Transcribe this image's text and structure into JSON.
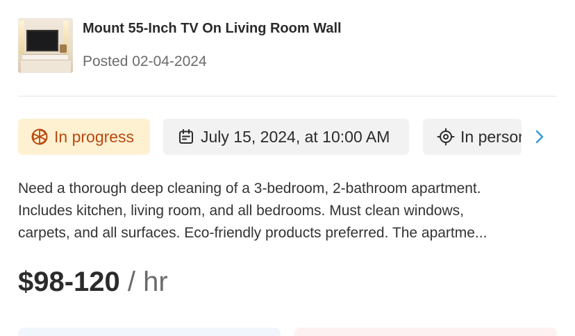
{
  "job": {
    "title": "Mount 55-Inch TV On Living Room Wall",
    "posted": "Posted 02-04-2024",
    "thumbnail_icon": "living-room-tv-photo"
  },
  "chips": {
    "status": {
      "label": "In progress",
      "icon": "in-progress-icon",
      "color": "#b84a10",
      "bg": "#fdf1d2"
    },
    "date": {
      "label": "July 15, 2024, at 10:00 AM",
      "icon": "calendar-icon"
    },
    "location": {
      "label": "In person",
      "icon": "location-target-icon"
    },
    "next_icon": "chevron-right-icon"
  },
  "description": {
    "lines": [
      "Need a thorough deep cleaning of a 3-bedroom, 2-bathroom apartment.",
      "Includes kitchen, living room, and all bedrooms. Must clean windows,",
      "carpets, and all surfaces. Eco-friendly products preferred. The apartme..."
    ]
  },
  "price": {
    "amount": "$98-120",
    "unit": " / hr"
  }
}
